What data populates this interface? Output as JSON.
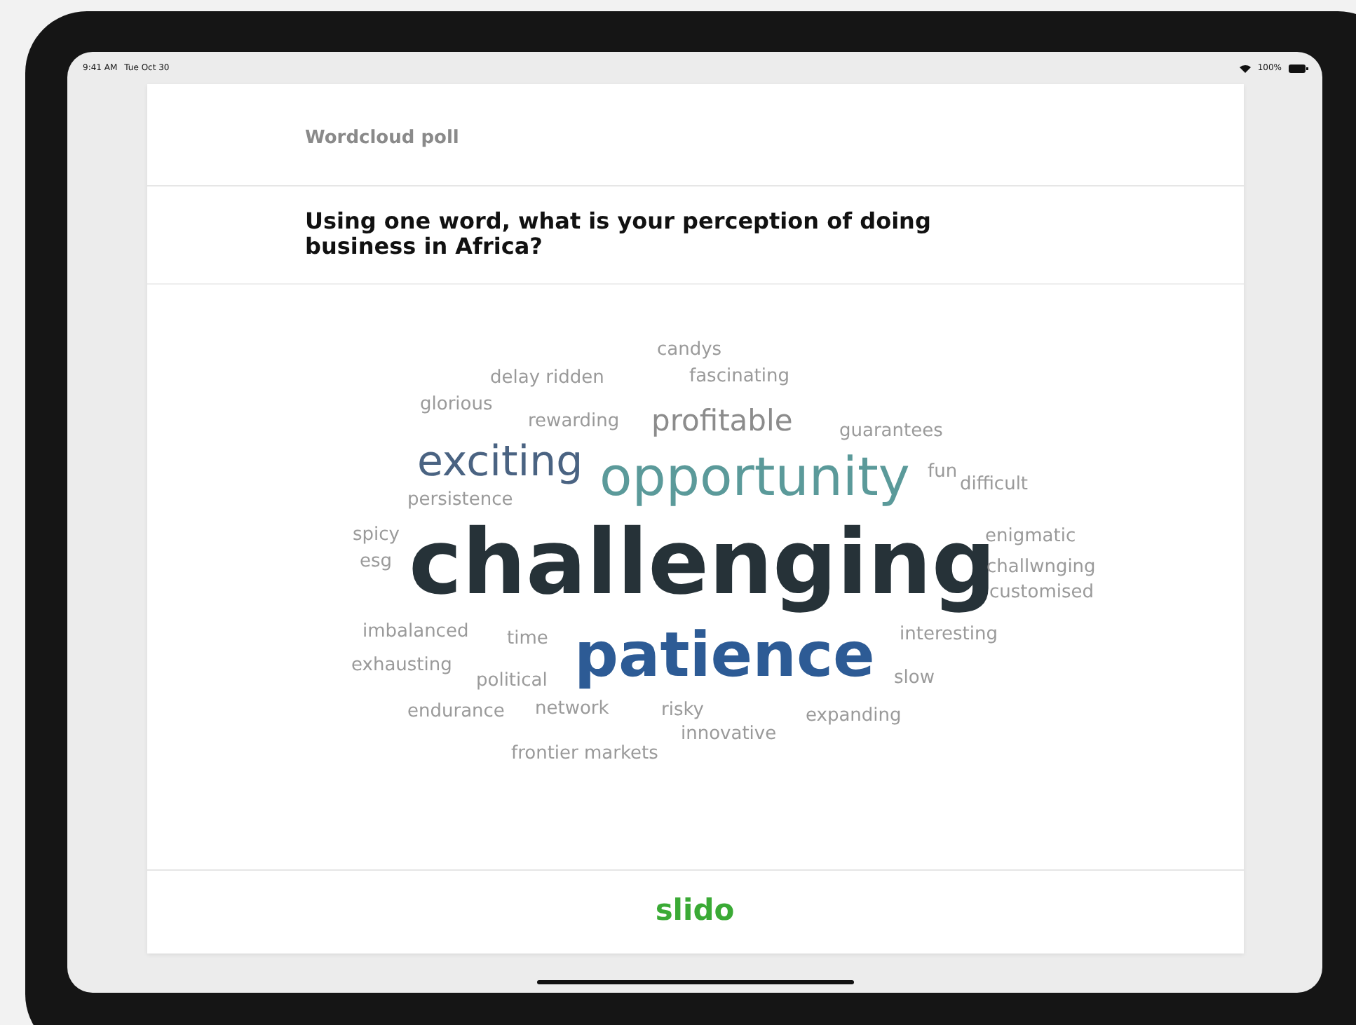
{
  "status_bar": {
    "time": "9:41 AM",
    "date": "Tue Oct 30",
    "battery": "100%"
  },
  "poll": {
    "type_label": "Wordcloud poll",
    "question": "Using one word, what is your perception of doing business in Africa?"
  },
  "wordcloud": {
    "words": [
      {
        "text": "candys",
        "kind": "small",
        "color": "#9a9a9a"
      },
      {
        "text": "delay ridden",
        "kind": "small",
        "color": "#9a9a9a"
      },
      {
        "text": "fascinating",
        "kind": "small",
        "color": "#9a9a9a"
      },
      {
        "text": "glorious",
        "kind": "small",
        "color": "#9a9a9a"
      },
      {
        "text": "rewarding",
        "kind": "small",
        "color": "#9a9a9a"
      },
      {
        "text": "profitable",
        "kind": "medium",
        "color": "#8c8c8c"
      },
      {
        "text": "guarantees",
        "kind": "small",
        "color": "#9a9a9a"
      },
      {
        "text": "exciting",
        "kind": "large",
        "color": "#4a6382"
      },
      {
        "text": "opportunity",
        "kind": "larger",
        "color": "#5b9a9a"
      },
      {
        "text": "fun",
        "kind": "small",
        "color": "#9a9a9a"
      },
      {
        "text": "difficult",
        "kind": "small",
        "color": "#9a9a9a"
      },
      {
        "text": "persistence",
        "kind": "small",
        "color": "#9a9a9a"
      },
      {
        "text": "spicy",
        "kind": "small",
        "color": "#9a9a9a"
      },
      {
        "text": "esg",
        "kind": "small",
        "color": "#9a9a9a"
      },
      {
        "text": "challenging",
        "kind": "top",
        "color": "#263238"
      },
      {
        "text": "enigmatic",
        "kind": "small",
        "color": "#9a9a9a"
      },
      {
        "text": "challwnging",
        "kind": "small",
        "color": "#9a9a9a"
      },
      {
        "text": "customised",
        "kind": "small",
        "color": "#9a9a9a"
      },
      {
        "text": "imbalanced",
        "kind": "small",
        "color": "#9a9a9a"
      },
      {
        "text": "time",
        "kind": "small",
        "color": "#9a9a9a"
      },
      {
        "text": "patience",
        "kind": "second",
        "color": "#2d5b95"
      },
      {
        "text": "interesting",
        "kind": "small",
        "color": "#9a9a9a"
      },
      {
        "text": "exhausting",
        "kind": "small",
        "color": "#9a9a9a"
      },
      {
        "text": "political",
        "kind": "small",
        "color": "#9a9a9a"
      },
      {
        "text": "slow",
        "kind": "small",
        "color": "#9a9a9a"
      },
      {
        "text": "endurance",
        "kind": "small",
        "color": "#9a9a9a"
      },
      {
        "text": "network",
        "kind": "small",
        "color": "#9a9a9a"
      },
      {
        "text": "risky",
        "kind": "small",
        "color": "#9a9a9a"
      },
      {
        "text": "expanding",
        "kind": "small",
        "color": "#9a9a9a"
      },
      {
        "text": "innovative",
        "kind": "small",
        "color": "#9a9a9a"
      },
      {
        "text": "frontier markets",
        "kind": "small",
        "color": "#9a9a9a"
      }
    ]
  },
  "footer": {
    "brand": "slido"
  }
}
